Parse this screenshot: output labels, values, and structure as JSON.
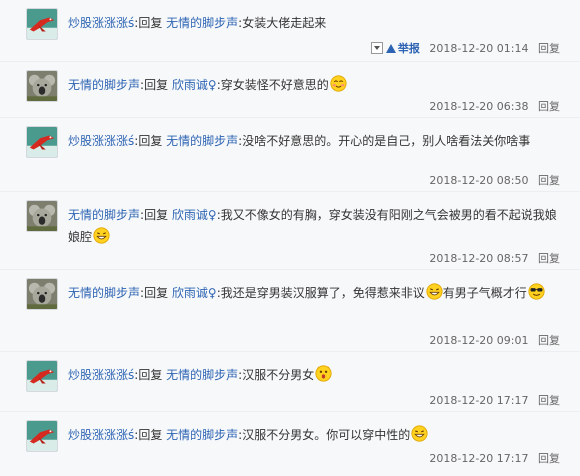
{
  "comments": [
    {
      "user": "炒股涨涨涨ś",
      "colon": ":",
      "reply_word": "回复",
      "target": "无情的脚步声",
      "text": ":女装大佬走起来",
      "time": "2018-12-20 01:14",
      "reply_btn": "回复",
      "report": "举报"
    },
    {
      "user": "无情的脚步声",
      "colon": ":",
      "reply_word": "回复",
      "target": "欣雨诚♀",
      "text": ":穿女装怪不好意思的",
      "time": "2018-12-20 06:38",
      "reply_btn": "回复"
    },
    {
      "user": "炒股涨涨涨ś",
      "colon": ":",
      "reply_word": "回复",
      "target": "无情的脚步声",
      "text": ":没啥不好意思的。开心的是自己，别人啥看法关你啥事",
      "time": "2018-12-20 08:50",
      "reply_btn": "回复"
    },
    {
      "user": "无情的脚步声",
      "colon": ":",
      "reply_word": "回复",
      "target": "欣雨诚♀",
      "text": ":我又不像女的有胸，穿女装没有阳刚之气会被男的看不起说我娘娘腔",
      "time": "2018-12-20 08:57",
      "reply_btn": "回复"
    },
    {
      "user": "无情的脚步声",
      "colon": ":",
      "reply_word": "回复",
      "target": "欣雨诚♀",
      "text": ":我还是穿男装汉服算了，免得惹来非议",
      "text2": "有男子气概才行",
      "time": "2018-12-20 09:01",
      "reply_btn": "回复"
    },
    {
      "user": "炒股涨涨涨ś",
      "colon": ":",
      "reply_word": "回复",
      "target": "无情的脚步声",
      "text": ":汉服不分男女",
      "time": "2018-12-20 17:17",
      "reply_btn": "回复"
    },
    {
      "user": "炒股涨涨涨ś",
      "colon": ":",
      "reply_word": "回复",
      "target": "无情的脚步声",
      "text": ":汉服不分男女。你可以穿中性的",
      "time": "2018-12-20 17:17",
      "reply_btn": "回复"
    }
  ],
  "icons": {
    "avatar_a": "dragon-avatar-icon",
    "avatar_b": "koala-avatar-icon",
    "emoji_shy": "shy-smile-emoji-icon",
    "emoji_grin": "grin-emoji-icon",
    "emoji_cool": "sunglasses-emoji-icon",
    "emoji_surprise": "surprised-emoji-icon"
  },
  "colors": {
    "link": "#2d64b3",
    "username": "#5c6c86",
    "text": "#333333",
    "meta": "#666666"
  }
}
